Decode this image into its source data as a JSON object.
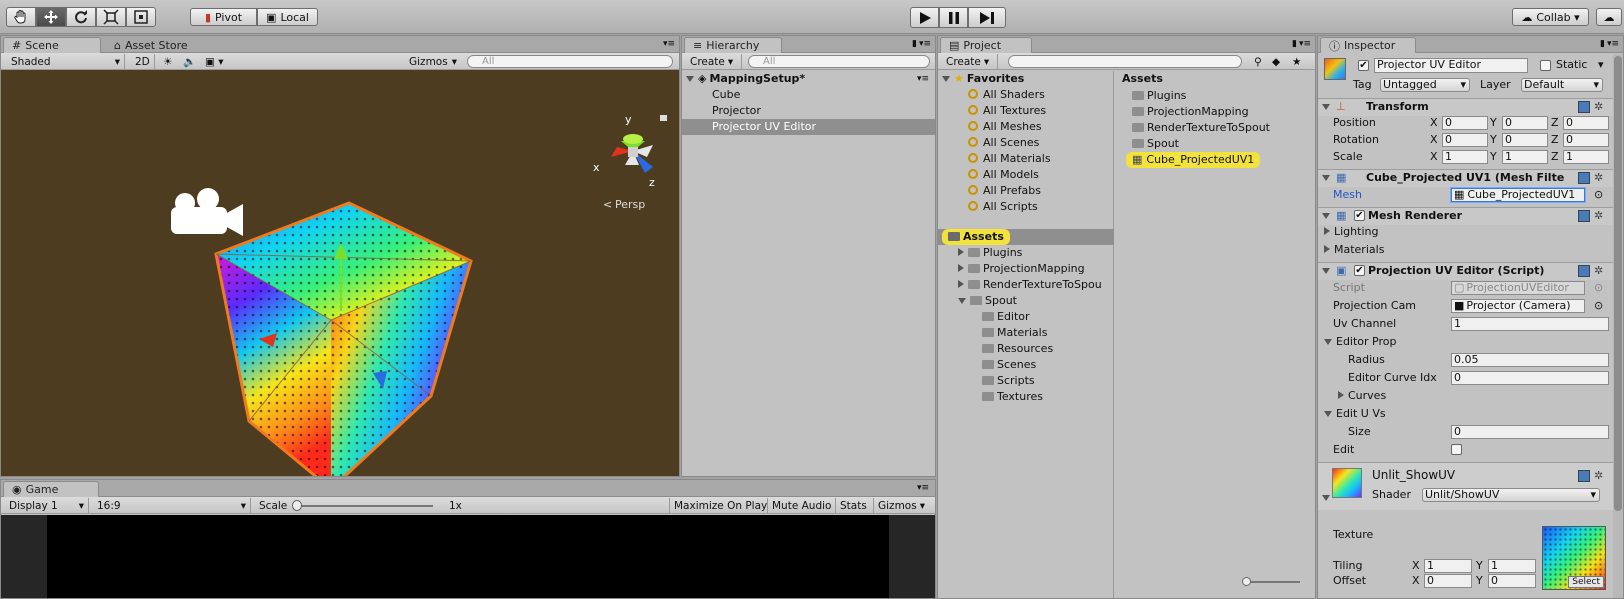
{
  "top_toolbar": {
    "pivot_label": "Pivot",
    "local_label": "Local",
    "collab_label": "Collab ▾"
  },
  "scene": {
    "tab_label": "Scene",
    "asset_store_tab": "Asset Store",
    "shading_mode": "Shaded",
    "mode_2d": "2D",
    "gizmos_label": "Gizmos",
    "search_placeholder": "All",
    "persp_label": "Persp",
    "axes": {
      "x": "x",
      "y": "y",
      "z": "z"
    }
  },
  "game": {
    "tab_label": "Game",
    "display": "Display 1",
    "aspect": "16:9",
    "scale_label": "Scale",
    "scale_value": "1x",
    "maximize_on_play": "Maximize On Play",
    "mute_audio": "Mute Audio",
    "stats": "Stats",
    "gizmos": "Gizmos"
  },
  "hierarchy": {
    "tab_label": "Hierarchy",
    "create_label": "Create",
    "search_placeholder": "All",
    "scene_name": "MappingSetup*",
    "items": [
      "Cube",
      "Projector",
      "Projector UV Editor"
    ]
  },
  "project": {
    "tab_label": "Project",
    "create_label": "Create",
    "favorites_label": "Favorites",
    "favorites": [
      "All Shaders",
      "All Textures",
      "All Meshes",
      "All Scenes",
      "All Materials",
      "All Models",
      "All Prefabs",
      "All Scripts"
    ],
    "assets_label": "Assets",
    "tree": [
      "Plugins",
      "ProjectionMapping",
      "RenderTextureToSpou",
      "Spout"
    ],
    "spout_children": [
      "Editor",
      "Materials",
      "Resources",
      "Scenes",
      "Scripts",
      "Textures"
    ],
    "assets_header": "Assets",
    "assets_items": [
      "Plugins",
      "ProjectionMapping",
      "RenderTextureToSpout",
      "Spout",
      "Cube_ProjectedUV1"
    ]
  },
  "inspector": {
    "tab_label": "Inspector",
    "object_name": "Projector UV Editor",
    "static_label": "Static",
    "tag_label": "Tag",
    "tag_value": "Untagged",
    "layer_label": "Layer",
    "layer_value": "Default",
    "transform": {
      "title": "Transform",
      "position_label": "Position",
      "rotation_label": "Rotation",
      "scale_label": "Scale",
      "position": [
        "0",
        "0",
        "0"
      ],
      "rotation": [
        "0",
        "0",
        "0"
      ],
      "scale": [
        "1",
        "1",
        "1"
      ],
      "x": "X",
      "y": "Y",
      "z": "Z"
    },
    "mesh_filter": {
      "title": "Cube_Projected UV1 (Mesh Filte",
      "mesh_label": "Mesh",
      "mesh_value": "Cube_ProjectedUV1"
    },
    "mesh_renderer": {
      "title": "Mesh Renderer",
      "lighting": "Lighting",
      "materials": "Materials"
    },
    "script_comp": {
      "title": "Projection UV Editor (Script)",
      "script_label": "Script",
      "script_value": "ProjectionUVEditor",
      "cam_label": "Projection Cam",
      "cam_value": "Projector (Camera)",
      "uv_label": "Uv Channel",
      "uv_value": "1",
      "editor_prop": "Editor Prop",
      "radius_label": "Radius",
      "radius_value": "0.05",
      "curve_idx_label": "Editor Curve Idx",
      "curve_idx_value": "0",
      "curves_label": "Curves",
      "edit_uvs": "Edit U Vs",
      "size_label": "Size",
      "size_value": "0",
      "edit_label": "Edit"
    },
    "material": {
      "name": "Unlit_ShowUV",
      "shader_label": "Shader",
      "shader_value": "Unlit/ShowUV",
      "texture_label": "Texture",
      "tiling_label": "Tiling",
      "offset_label": "Offset",
      "tiling": [
        "1",
        "1"
      ],
      "offset": [
        "0",
        "0"
      ],
      "select_label": "Select"
    }
  },
  "colors": {
    "scene_bg": "#4e3c21",
    "selection_yellow": "#f1e23c",
    "cube_outline": "#f27a1e"
  }
}
